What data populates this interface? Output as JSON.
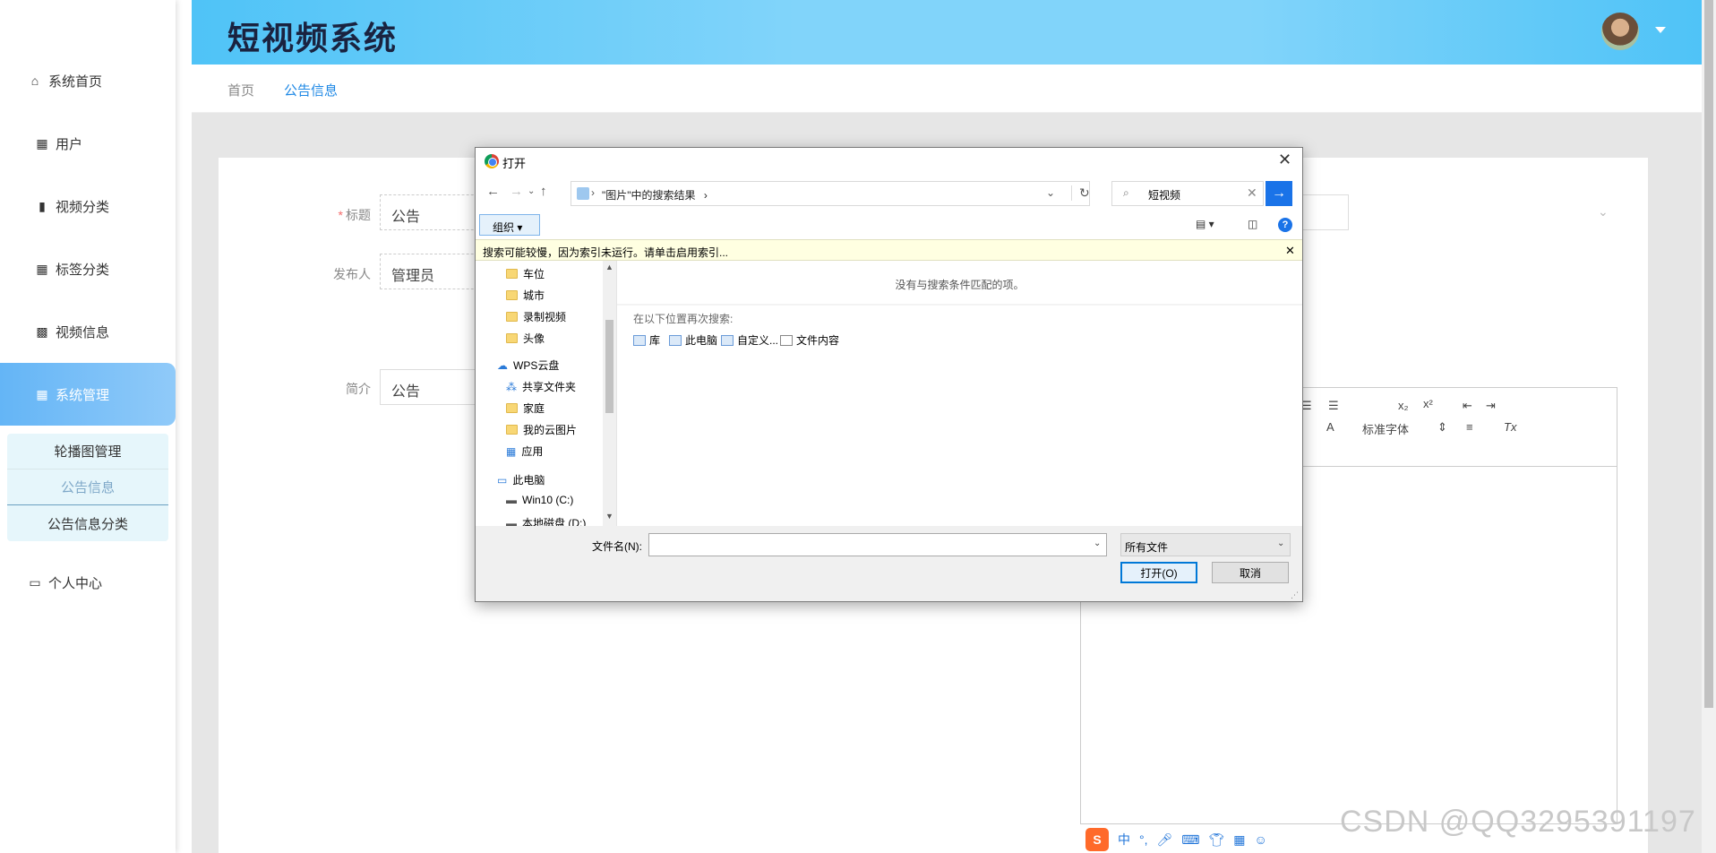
{
  "app": {
    "title": "短视频系统"
  },
  "sidebar": {
    "items": [
      {
        "label": "系统首页",
        "icon": "home-icon"
      },
      {
        "label": "用户",
        "icon": "grid-icon"
      },
      {
        "label": "视频分类",
        "icon": "book-icon"
      },
      {
        "label": "标签分类",
        "icon": "grid-icon"
      },
      {
        "label": "视频信息",
        "icon": "apps-icon"
      },
      {
        "label": "系统管理",
        "icon": "grid-icon"
      },
      {
        "label": "个人中心",
        "icon": "wallet-icon"
      }
    ],
    "submenu": [
      "轮播图管理",
      "公告信息",
      "公告信息分类"
    ],
    "active_color": "#64b5f6"
  },
  "breadcrumb": {
    "home": "首页",
    "current": "公告信息"
  },
  "form": {
    "title_label": "标题",
    "title_value": "公告",
    "publisher_label": "发布人",
    "publisher_value": "管理员",
    "intro_label": "简介",
    "intro_value": "公告",
    "font_select": "标准字体"
  },
  "dialog": {
    "title": "打开",
    "path": "\"图片\"中的搜索结果",
    "search_value": "短视频",
    "organize": "组织",
    "info_text": "搜索可能较慢，因为索引未运行。请单击启用索引...",
    "no_match": "没有与搜索条件匹配的项。",
    "search_again": "在以下位置再次搜索:",
    "search_again_items": [
      "库",
      "此电脑",
      "自定义...",
      "文件内容"
    ],
    "tree": [
      "车位",
      "城市",
      "录制视频",
      "头像",
      "WPS云盘",
      "共享文件夹",
      "家庭",
      "我的云图片",
      "应用",
      "此电脑",
      "Win10 (C:)",
      "本地磁盘 (D:)"
    ],
    "filename_label": "文件名(N):",
    "filetype": "所有文件",
    "open_button": "打开(O)",
    "cancel_button": "取消"
  },
  "watermark": "CSDN @QQ3295391197",
  "ime": {
    "label": "中"
  }
}
